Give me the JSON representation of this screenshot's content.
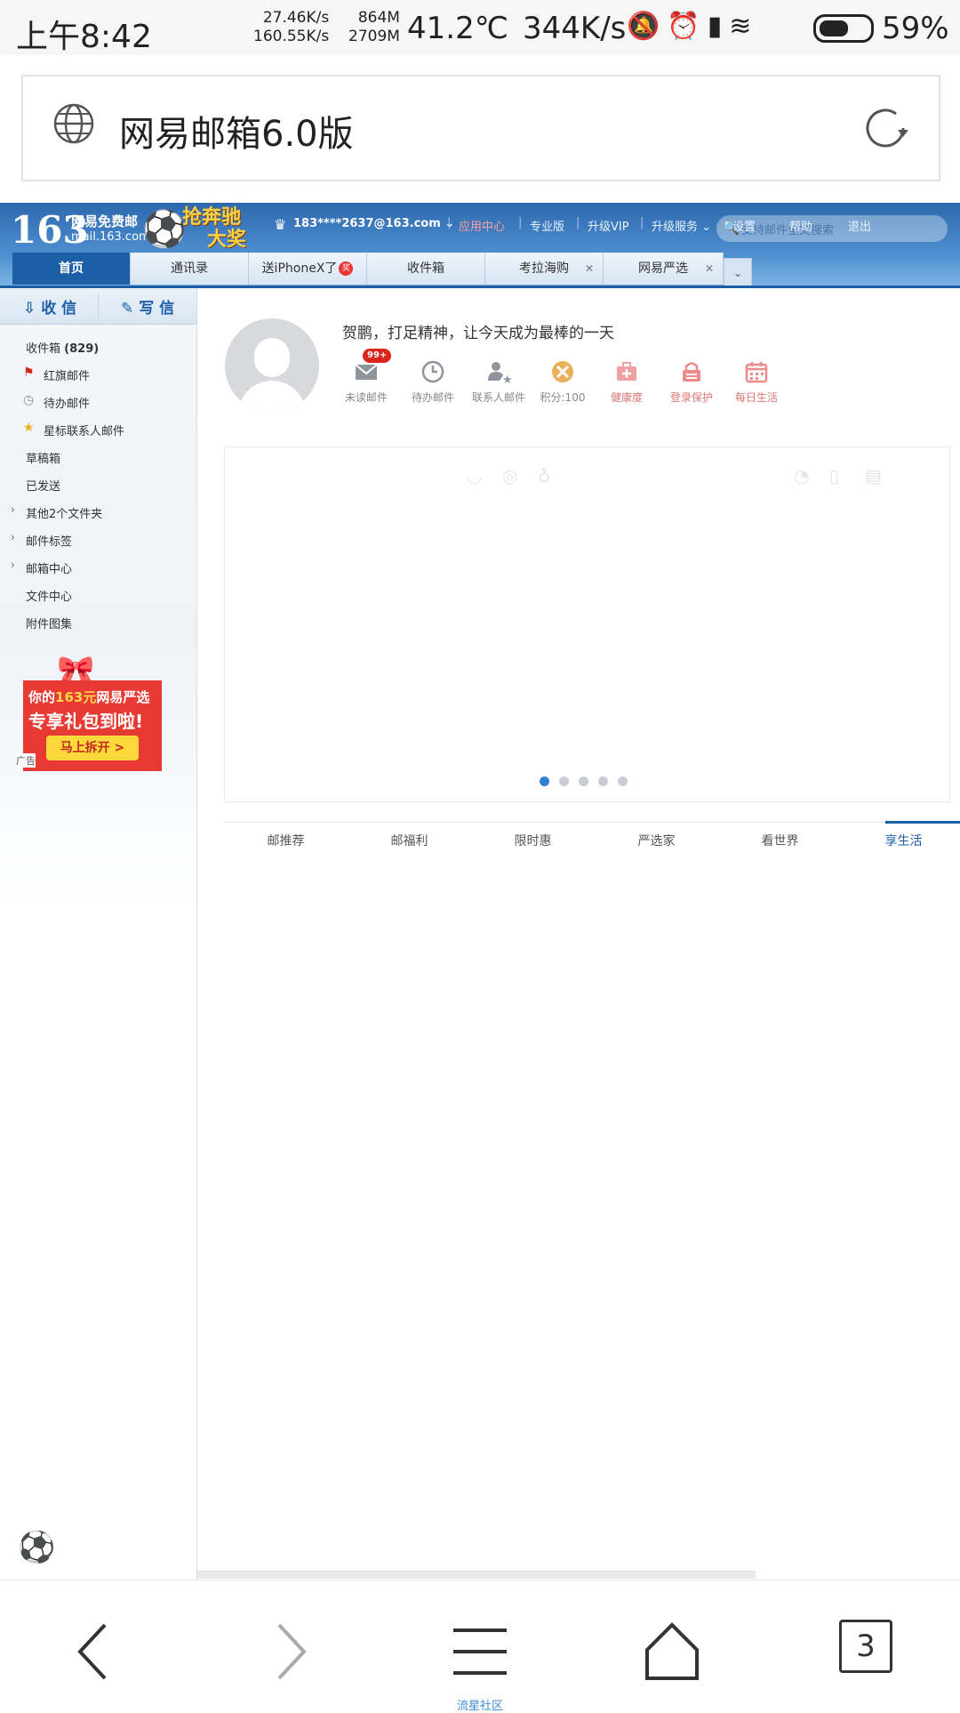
{
  "status_bar": {
    "time": "上午8:42",
    "net_up": "27.46K/s",
    "net_down": "160.55K/s",
    "mem_used": "864M",
    "mem_total": "2709M",
    "temperature": "41.2℃",
    "speed": "344K/s",
    "battery": "59%",
    "battery_level": 0.59,
    "icons": [
      "mute-icon",
      "alarm-icon",
      "signal-icon",
      "wifi-icon",
      "battery-icon"
    ]
  },
  "browser": {
    "page_title": "网易邮箱6.0版"
  },
  "mail_header": {
    "logo_number": "163",
    "logo_line1": "网易免费邮",
    "logo_line2": "mail.163.com",
    "promo_line1": "抢奔驰",
    "promo_line2": "大奖",
    "account": "183****2637@163.com",
    "nav": [
      "应用中心",
      "专业版",
      "升级VIP",
      "升级服务",
      "设置",
      "帮助",
      "退出"
    ],
    "search_placeholder": "支持邮件全文搜索"
  },
  "tabs": [
    {
      "label": "首页",
      "active": true
    },
    {
      "label": "通讯录"
    },
    {
      "label": "送iPhoneX了",
      "badge": "奖"
    },
    {
      "label": "收件箱"
    },
    {
      "label": "考拉海购",
      "closable": true
    },
    {
      "label": "网易严选",
      "closable": true
    }
  ],
  "sidebar": {
    "receive": "收 信",
    "compose": "写 信",
    "folders": [
      {
        "label": "收件箱",
        "count": "(829)"
      },
      {
        "label": "红旗邮件",
        "icon": "red-flag-icon"
      },
      {
        "label": "待办邮件",
        "icon": "clock-icon"
      },
      {
        "label": "星标联系人邮件",
        "icon": "star-icon"
      },
      {
        "label": "草稿箱"
      },
      {
        "label": "已发送"
      },
      {
        "label": "其他2个文件夹",
        "expandable": true
      },
      {
        "label": "邮件标签",
        "expandable": true
      },
      {
        "label": "邮箱中心",
        "expandable": true
      },
      {
        "label": "文件中心"
      },
      {
        "label": "附件图集"
      }
    ],
    "ad": {
      "line1_pre": "你的",
      "line1_hl": "163元",
      "line1_post": "网易严选",
      "line2": "专享礼包到啦!",
      "button": "马上拆开 >",
      "tag": "广告"
    }
  },
  "main": {
    "greeting": "贺鹏，打足精神，让今天成为最棒的一天",
    "quick_items": [
      {
        "label": "未读邮件",
        "badge": "99+",
        "icon": "envelope-icon"
      },
      {
        "label": "待办邮件",
        "icon": "clock-icon"
      },
      {
        "label": "联系人邮件",
        "icon": "contact-star-icon"
      },
      {
        "label": "积分:100",
        "icon": "points-icon"
      },
      {
        "label": "健康度",
        "icon": "health-kit-icon"
      },
      {
        "label": "登录保护",
        "icon": "lock-icon"
      },
      {
        "label": "每日生活",
        "icon": "calendar-icon"
      }
    ],
    "carousel_pages": 5,
    "carousel_active": 0,
    "subtabs": [
      "邮推荐",
      "邮福利",
      "限时惠",
      "严选家",
      "看世界",
      "享生活"
    ],
    "subtab_active": 5
  },
  "bottom_nav": {
    "hint": "流星社区",
    "tab_count": "3"
  },
  "colors": {
    "brand_blue": "#1d5fa7",
    "badge_red": "#d9251d",
    "promo_gold": "#f7d14a"
  }
}
